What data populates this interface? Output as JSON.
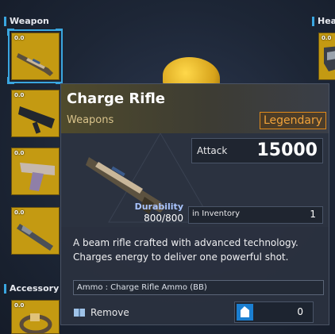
{
  "sections": {
    "weapon_label": "Weapon",
    "accessory_label": "Accessory",
    "head_label": "Head"
  },
  "slots": {
    "weapon": [
      {
        "durability": "0.0",
        "icon": "rifle-icon"
      },
      {
        "durability": "0.0",
        "icon": "launcher-icon"
      },
      {
        "durability": "0.0",
        "icon": "pistol-icon"
      },
      {
        "durability": "0.0",
        "icon": "shotgun-icon"
      }
    ],
    "accessory": [
      {
        "durability": "0.0",
        "icon": "ring-icon"
      }
    ],
    "head": [
      {
        "durability": "0.0",
        "icon": "helmet-icon"
      }
    ]
  },
  "tooltip": {
    "title": "Charge Rifle",
    "category": "Weapons",
    "rarity": "Legendary",
    "attack_label": "Attack",
    "attack_value": "15000",
    "durability_label": "Durability",
    "durability_value": "800/800",
    "inventory_label": "in Inventory",
    "inventory_value": "1",
    "description_line1": "A beam rifle crafted with advanced technology.",
    "description_line2": "Charges energy to deliver one powerful shot.",
    "ammo_text": "Ammo : Charge Rifle Ammo (BB)",
    "remove_label": "Remove",
    "quantity_value": "0"
  },
  "colors": {
    "accent": "#3aa6e0",
    "slot_bg": "#c49a12",
    "rarity": "#f0a23a",
    "tooltip_bg": "#2a313f"
  }
}
